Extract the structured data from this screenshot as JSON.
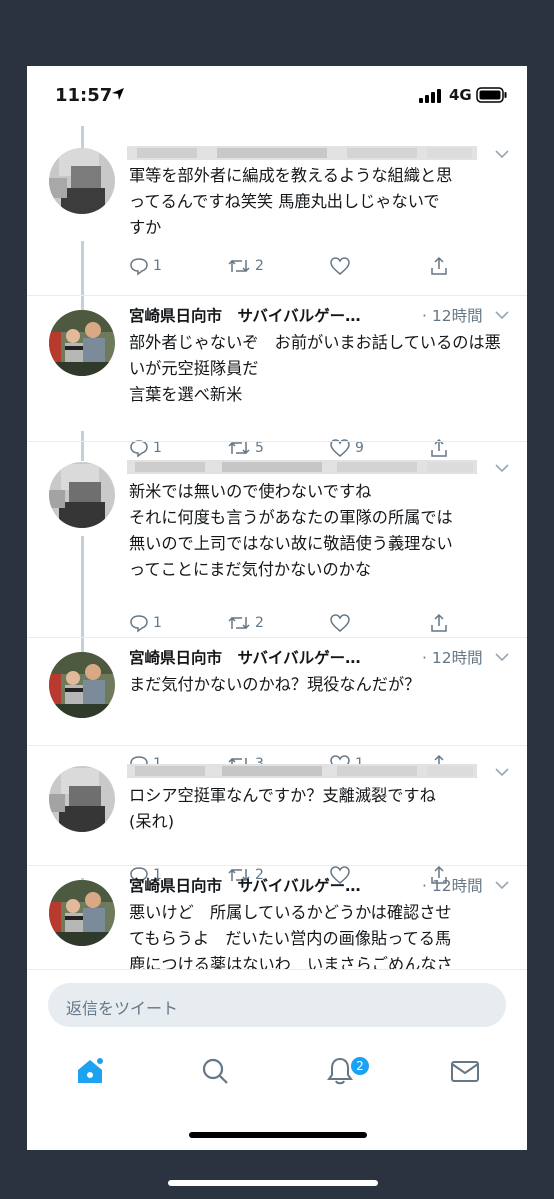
{
  "status_bar": {
    "time": "11:57",
    "network": "4G",
    "icons": [
      "location-arrow-icon",
      "signal-icon",
      "battery-icon"
    ]
  },
  "tweets": [
    {
      "author": "",
      "author_blurred": true,
      "time": "",
      "text": "軍等を部外者に編成を教えるような組織と思\nってるんですね笑笑 馬鹿丸出しじゃないで\nすか",
      "reply_count": "1",
      "retweet_count": "2",
      "like_count": ""
    },
    {
      "author": "宮崎県日向市　サバイバルゲー…",
      "author_blurred": false,
      "time": "· 12時間",
      "text": "部外者じゃないぞ　お前がいまお話しているのは悪いが元空挺隊員だ\n言葉を選べ新米",
      "reply_count": "1",
      "retweet_count": "5",
      "like_count": "9"
    },
    {
      "author": "",
      "author_blurred": true,
      "time": "",
      "text": "新米では無いので使わないですね\nそれに何度も言うがあなたの軍隊の所属では\n無いので上司ではない故に敬語使う義理ない\nってことにまだ気付かないのかな",
      "reply_count": "1",
      "retweet_count": "2",
      "like_count": ""
    },
    {
      "author": "宮崎県日向市　サバイバルゲー…",
      "author_blurred": false,
      "time": "· 12時間",
      "text": "まだ気付かないのかね？現役なんだが？",
      "reply_count": "1",
      "retweet_count": "3",
      "like_count": "1"
    },
    {
      "author": "",
      "author_blurred": true,
      "time": "",
      "text": "ロシア空挺軍なんですか？支離滅裂ですね\n(呆れ)",
      "reply_count": "1",
      "retweet_count": "2",
      "like_count": ""
    },
    {
      "author": "宮崎県日向市　サバイバルゲー…",
      "author_blurred": false,
      "time": "· 12時間",
      "text": "悪いけど　所属しているかどうかは確認させ\nてもらうよ　だいたい営内の画像貼ってる馬\n鹿につける薬はないわ　いまさらごめんなさ",
      "reply_count": "",
      "retweet_count": "",
      "like_count": ""
    }
  ],
  "reply_bar": {
    "placeholder": "返信をツイート"
  },
  "tabbar": {
    "items": [
      "home-icon",
      "search-icon",
      "notifications-icon",
      "messages-icon"
    ],
    "notification_badge": "2"
  },
  "colors": {
    "accent": "#1da1f2",
    "secondary_text": "#657786",
    "divider": "#e6ecf0",
    "background": "#2b3340"
  }
}
